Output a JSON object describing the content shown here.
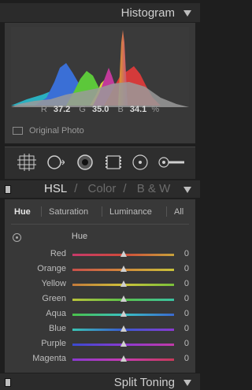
{
  "histogram": {
    "title": "Histogram",
    "readout": {
      "r_label": "R",
      "r": "37.2",
      "g_label": "G",
      "g": "35.0",
      "b_label": "B",
      "b": "34.1",
      "unit": "%"
    },
    "original_photo_label": "Original Photo"
  },
  "tools": [
    "grid-overlay-icon",
    "crop-icon",
    "spot-removal-icon",
    "graduated-filter-icon",
    "radial-filter-icon",
    "adjustment-brush-icon"
  ],
  "hsl": {
    "tabs": [
      "HSL",
      "Color",
      "B & W"
    ],
    "active_tab": "HSL",
    "subtabs": [
      "Hue",
      "Saturation",
      "Luminance",
      "All"
    ],
    "active_subtab": "Hue",
    "section_title": "Hue",
    "sliders": [
      {
        "label": "Red",
        "value": "0",
        "gradient": [
          "#c63a6a",
          "#d04a3a",
          "#c8a23a"
        ]
      },
      {
        "label": "Orange",
        "value": "0",
        "gradient": [
          "#c8504a",
          "#d2883a",
          "#c8c23a"
        ]
      },
      {
        "label": "Yellow",
        "value": "0",
        "gradient": [
          "#c47a3a",
          "#cfc23a",
          "#7ac23a"
        ]
      },
      {
        "label": "Green",
        "value": "0",
        "gradient": [
          "#b8c23a",
          "#5ac24a",
          "#3ac2a2"
        ]
      },
      {
        "label": "Aqua",
        "value": "0",
        "gradient": [
          "#4ac24a",
          "#3ac2c2",
          "#3a6ad0"
        ]
      },
      {
        "label": "Blue",
        "value": "0",
        "gradient": [
          "#3ac2b2",
          "#3a5ad2",
          "#8a3ad0"
        ]
      },
      {
        "label": "Purple",
        "value": "0",
        "gradient": [
          "#3a4ad0",
          "#8a3ad2",
          "#c23aa8"
        ]
      },
      {
        "label": "Magenta",
        "value": "0",
        "gradient": [
          "#8a3ad0",
          "#c83ab2",
          "#c83a5a"
        ]
      }
    ],
    "thumb_position": 0.5
  },
  "split_toning": {
    "title": "Split Toning"
  }
}
